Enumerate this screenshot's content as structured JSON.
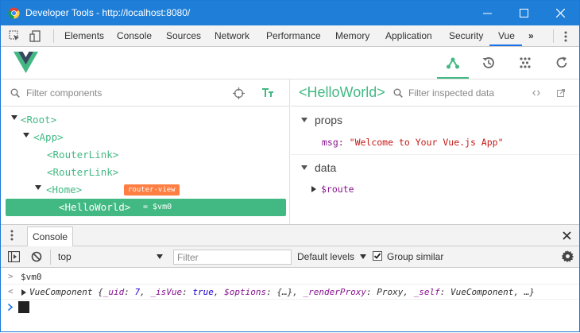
{
  "window": {
    "title": "Developer Tools - http://localhost:8080/"
  },
  "devtools_tabs": [
    {
      "label": "Elements"
    },
    {
      "label": "Console"
    },
    {
      "label": "Sources"
    },
    {
      "label": "Network"
    },
    {
      "label": "Performance"
    },
    {
      "label": "Memory"
    },
    {
      "label": "Application"
    },
    {
      "label": "Security"
    },
    {
      "label": "Vue",
      "active": true
    }
  ],
  "devtools_overflow": "»",
  "vue": {
    "accent_color": "#42b983",
    "nav": [
      {
        "icon": "components-icon",
        "active": true
      },
      {
        "icon": "history-icon"
      },
      {
        "icon": "vuex-icon"
      },
      {
        "icon": "refresh-icon"
      }
    ],
    "components_filter_placeholder": "Filter components",
    "tree": [
      {
        "label": "<Root>",
        "expanded": true
      },
      {
        "label": "<App>",
        "expanded": true
      },
      {
        "label": "<RouterLink>"
      },
      {
        "label": "<RouterLink>"
      },
      {
        "label": "<Home>",
        "expanded": true,
        "badge": "router-view"
      },
      {
        "label": "<HelloWorld>",
        "selected": true,
        "ref": "= $vm0"
      }
    ],
    "inspector": {
      "component_name": "<HelloWorld>",
      "filter_placeholder": "Filter inspected data",
      "sections": [
        {
          "title": "props",
          "items": [
            {
              "key": "msg",
              "value": "\"Welcome to Your Vue.js App\""
            }
          ]
        },
        {
          "title": "data",
          "items": [
            {
              "key": "$route"
            }
          ]
        }
      ]
    }
  },
  "console": {
    "tab_label": "Console",
    "context": "top",
    "filter_placeholder": "Filter",
    "levels": "Default levels",
    "group_similar_label": "Group similar",
    "group_similar_checked": true,
    "input_line": "$vm0",
    "output": {
      "type": "VueComponent",
      "props": [
        {
          "key": "_uid",
          "value": "7"
        },
        {
          "key": "_isVue",
          "value": "true"
        },
        {
          "key": "$options",
          "value": "{…}"
        },
        {
          "key": "_renderProxy",
          "value": "Proxy"
        },
        {
          "key": "_self",
          "value": "VueComponent"
        }
      ],
      "trailing": "…}"
    }
  }
}
